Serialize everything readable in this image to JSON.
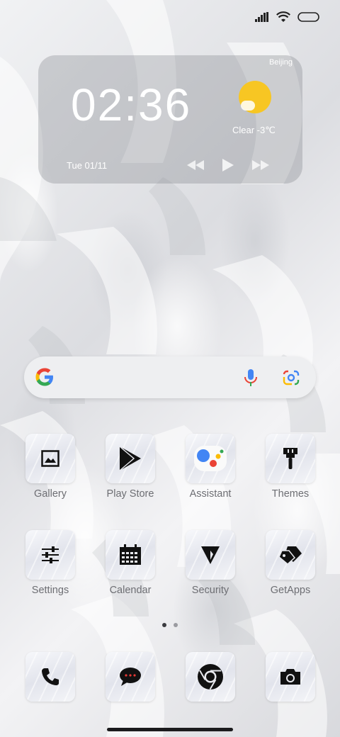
{
  "widget": {
    "city": "Beijing",
    "time": "02:36",
    "condition": "Clear  -3℃",
    "date": "Tue 01/11",
    "weather_icon": "sunny-icon",
    "controls": [
      "previous-icon",
      "play-icon",
      "next-icon"
    ]
  },
  "search": {
    "logo": "google-icon",
    "voice_icon": "mic-icon",
    "lens_icon": "lens-icon"
  },
  "apps": [
    {
      "label": "Gallery",
      "icon": "gallery-icon"
    },
    {
      "label": "Play Store",
      "icon": "play-store-icon"
    },
    {
      "label": "Assistant",
      "icon": "assistant-icon"
    },
    {
      "label": "Themes",
      "icon": "brush-icon"
    },
    {
      "label": "Settings",
      "icon": "sliders-icon"
    },
    {
      "label": "Calendar",
      "icon": "calendar-icon"
    },
    {
      "label": "Security",
      "icon": "security-icon"
    },
    {
      "label": "GetApps",
      "icon": "tags-icon"
    }
  ],
  "dock": [
    {
      "icon": "phone-icon"
    },
    {
      "icon": "messages-icon"
    },
    {
      "icon": "chrome-icon"
    },
    {
      "icon": "camera-icon"
    }
  ],
  "pager": {
    "pages": 2,
    "current": 1
  },
  "colors": {
    "accent_sun": "#f7c623",
    "label": "#6d6e73"
  }
}
